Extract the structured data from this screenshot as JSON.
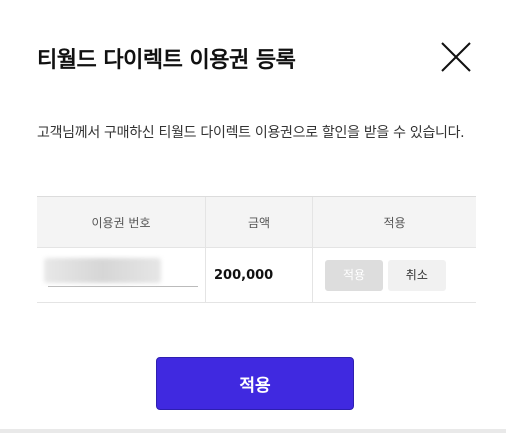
{
  "modal": {
    "title": "티월드 다이렉트 이용권 등록",
    "description": "고객님께서 구매하신 티월드 다이렉트 이용권으로 할인을 받을 수 있습니다.",
    "table": {
      "headers": [
        "이용권 번호",
        "금액",
        "적용"
      ],
      "row": {
        "code_value": "",
        "amount": "200,000",
        "apply_label": "적용",
        "cancel_label": "취소"
      }
    },
    "submit_label": "적용",
    "icons": {
      "close": "close-icon"
    },
    "colors": {
      "primary": "#4029e0",
      "header_bg": "#f4f4f4",
      "disabled_btn": "#dddddd"
    }
  }
}
